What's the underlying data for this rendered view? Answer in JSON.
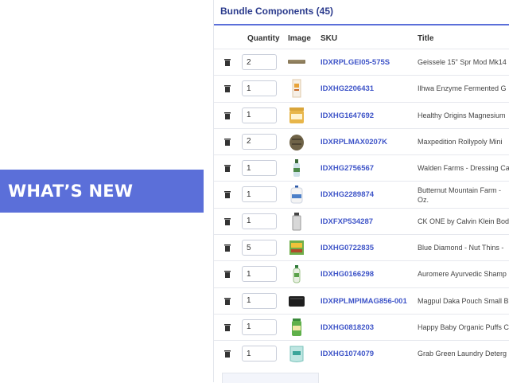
{
  "banner": {
    "text": "WHAT’S NEW"
  },
  "panel": {
    "title": "Bundle Components (45)",
    "columns": [
      "Quantity",
      "Image",
      "SKU",
      "Title"
    ]
  },
  "rows": [
    {
      "qty": "2",
      "sku": "IDXRPLGEI05-575S",
      "title": "Geissele 15\" Spr Mod Mk14",
      "image_icon": "rail-handguard"
    },
    {
      "qty": "1",
      "sku": "IDXHG2206431",
      "title": "Ilhwa Enzyme Fermented G",
      "image_icon": "supplement-box"
    },
    {
      "qty": "1",
      "sku": "IDXHG1647692",
      "title": "Healthy Origins Magnesium",
      "image_icon": "supplement-jar"
    },
    {
      "qty": "2",
      "sku": "IDXRPLMAX0207K",
      "title": "Maxpedition Rollypoly Mini",
      "image_icon": "pouch"
    },
    {
      "qty": "1",
      "sku": "IDXHG2756567",
      "title": "Walden Farms - Dressing Ca",
      "image_icon": "dressing-bottle"
    },
    {
      "qty": "1",
      "sku": "IDXHG2289874",
      "title": "Butternut Mountain Farm - Oz.",
      "image_icon": "syrup-jug"
    },
    {
      "qty": "1",
      "sku": "IDXFXP534287",
      "title": "CK ONE by Calvin Klein Bod",
      "image_icon": "perfume-bottle"
    },
    {
      "qty": "5",
      "sku": "IDXHG0722835",
      "title": "Blue Diamond - Nut Thins -",
      "image_icon": "cracker-box"
    },
    {
      "qty": "1",
      "sku": "IDXHG0166298",
      "title": "Auromere Ayurvedic Shamp",
      "image_icon": "shampoo-bottle"
    },
    {
      "qty": "1",
      "sku": "IDXRPLMPIMAG856-001",
      "title": "Magpul Daka Pouch Small B",
      "image_icon": "black-pouch"
    },
    {
      "qty": "1",
      "sku": "IDXHG0818203",
      "title": "Happy Baby Organic Puffs C",
      "image_icon": "puffs-canister"
    },
    {
      "qty": "1",
      "sku": "IDXHG1074079",
      "title": "Grab Green Laundry Deterg",
      "image_icon": "detergent-bag"
    }
  ],
  "colors": {
    "accent": "#5b6fd9",
    "sku_link": "#3f55c8",
    "title_text": "#2a3a8c"
  }
}
